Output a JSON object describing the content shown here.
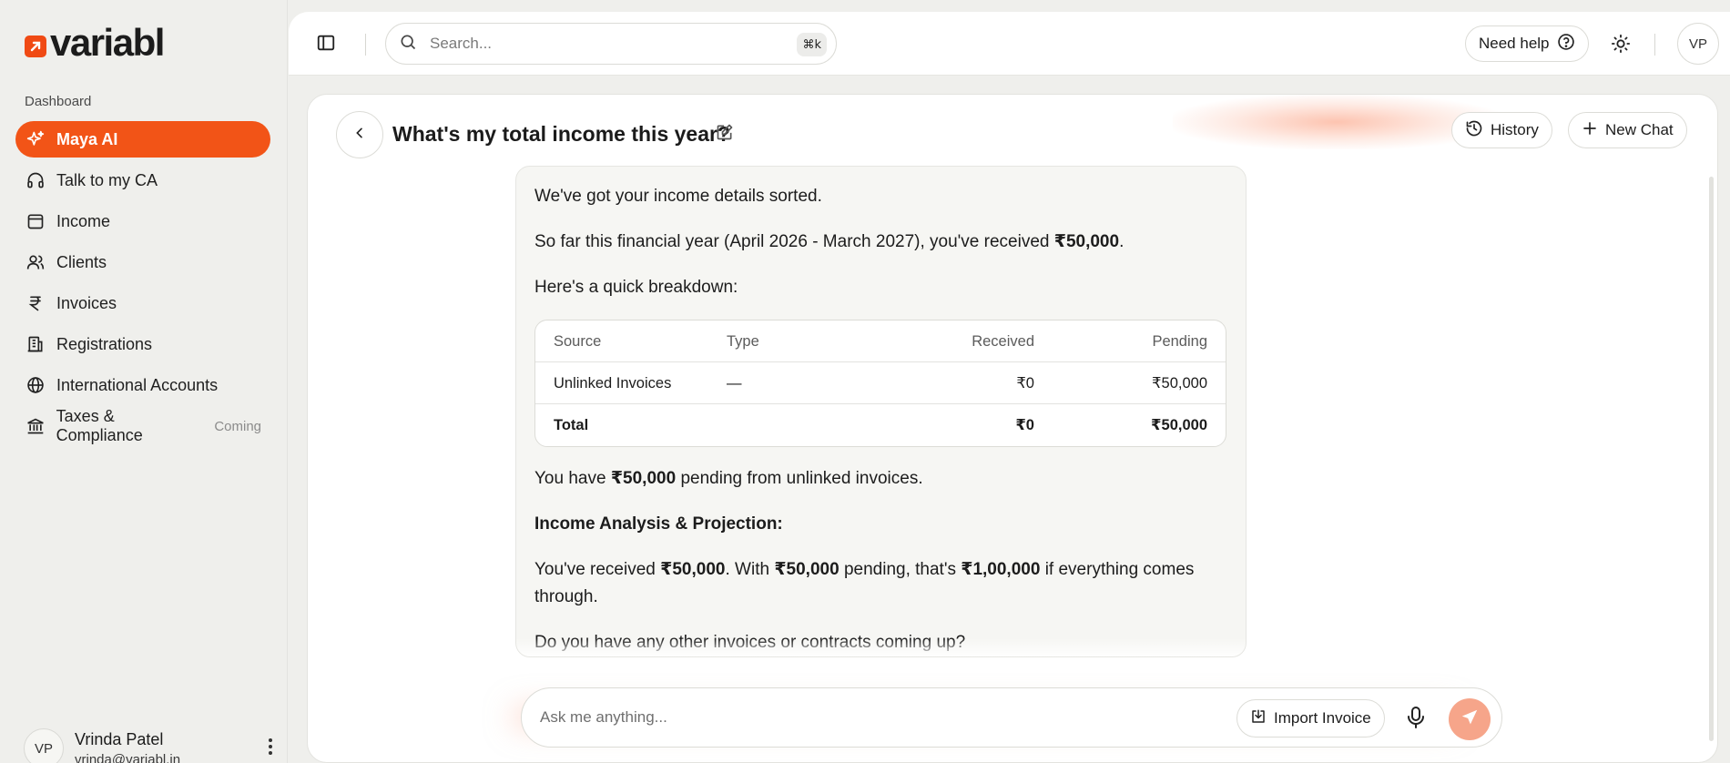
{
  "app": {
    "logo_text": "variabl",
    "brand_color": "#f25417"
  },
  "sidebar": {
    "section_label": "Dashboard",
    "items": [
      {
        "label": "Maya AI",
        "icon": "sparkles-icon",
        "active": true
      },
      {
        "label": "Talk to my CA",
        "icon": "headphones-icon"
      },
      {
        "label": "Income",
        "icon": "wallet-icon"
      },
      {
        "label": "Clients",
        "icon": "users-icon"
      },
      {
        "label": "Invoices",
        "icon": "rupee-icon"
      },
      {
        "label": "Registrations",
        "icon": "building-icon"
      },
      {
        "label": "International Accounts",
        "icon": "globe-icon"
      },
      {
        "label": "Taxes & Compliance",
        "icon": "bank-icon",
        "badge": "Coming"
      }
    ],
    "user": {
      "initials": "VP",
      "name": "Vrinda Patel",
      "email": "vrinda@variabl.in"
    }
  },
  "topbar": {
    "search_placeholder": "Search...",
    "shortcut": "⌘k",
    "help_label": "Need help",
    "avatar_initials": "VP"
  },
  "chat": {
    "title": "What's my total income this year?",
    "history_label": "History",
    "new_chat_label": "New Chat",
    "message": {
      "p1": "We've got your income details sorted.",
      "p2_pre": "So far this financial year (April 2026 - March 2027), you've received ",
      "p2_bold": "₹50,000",
      "p2_post": ".",
      "p3": "Here's a quick breakdown:",
      "table": {
        "headers": [
          "Source",
          "Type",
          "Received",
          "Pending"
        ],
        "rows": [
          [
            "Unlinked Invoices",
            "—",
            "₹0",
            "₹50,000"
          ]
        ],
        "total": [
          "Total",
          "",
          "₹0",
          "₹50,000"
        ]
      },
      "p4_pre": "You have ",
      "p4_bold": "₹50,000",
      "p4_post": " pending from unlinked invoices.",
      "p5": "Income Analysis & Projection:",
      "p6_a": "You've received ",
      "p6_b": "₹50,000",
      "p6_c": ". With ",
      "p6_d": "₹50,000",
      "p6_e": " pending, that's ",
      "p6_f": "₹1,00,000",
      "p6_g": " if everything comes through.",
      "p7": "Do you have any other invoices or contracts coming up?"
    },
    "input_placeholder": "Ask me anything...",
    "import_label": "Import Invoice"
  }
}
